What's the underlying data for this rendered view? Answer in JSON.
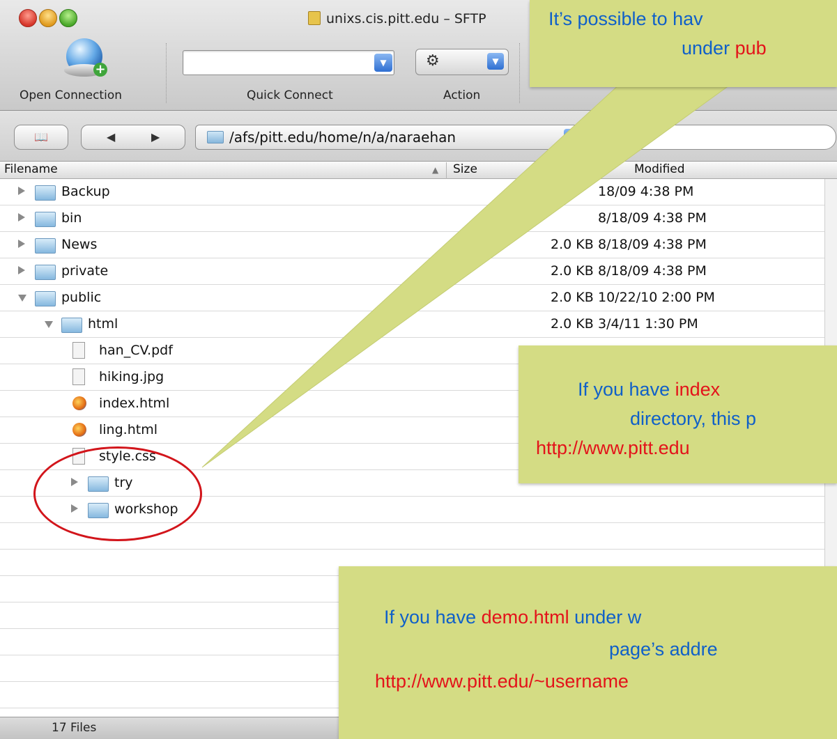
{
  "window": {
    "title": "unixs.cis.pitt.edu – SFTP"
  },
  "toolbar": {
    "open_connection": "Open Connection",
    "quick_connect": "Quick Connect",
    "action": "Action"
  },
  "nav": {
    "path": "/afs/pitt.edu/home/n/a/naraehan"
  },
  "columns": {
    "filename": "Filename",
    "size": "Size",
    "modified": "Modified"
  },
  "files": [
    {
      "name": "Backup",
      "kind": "folder-special",
      "disclosure": "closed",
      "depth": 0,
      "size": "",
      "modified": "18/09 4:38 PM"
    },
    {
      "name": "bin",
      "kind": "folder-special",
      "disclosure": "closed",
      "depth": 0,
      "size": "",
      "modified": "8/18/09 4:38 PM"
    },
    {
      "name": "News",
      "kind": "folder",
      "disclosure": "closed",
      "depth": 0,
      "size": "2.0 KB",
      "modified": "8/18/09 4:38 PM"
    },
    {
      "name": "private",
      "kind": "folder",
      "disclosure": "closed",
      "depth": 0,
      "size": "2.0 KB",
      "modified": "8/18/09 4:38 PM"
    },
    {
      "name": "public",
      "kind": "folder",
      "disclosure": "open",
      "depth": 0,
      "size": "2.0 KB",
      "modified": "10/22/10 2:00 PM"
    },
    {
      "name": "html",
      "kind": "folder",
      "disclosure": "open",
      "depth": 1,
      "size": "2.0 KB",
      "modified": "3/4/11 1:30 PM"
    },
    {
      "name": "han_CV.pdf",
      "kind": "file",
      "disclosure": "none",
      "depth": 2,
      "size": "",
      "modified": ""
    },
    {
      "name": "hiking.jpg",
      "kind": "file",
      "disclosure": "none",
      "depth": 2,
      "size": "",
      "modified": ""
    },
    {
      "name": "index.html",
      "kind": "html",
      "disclosure": "none",
      "depth": 2,
      "size": "",
      "modified": ""
    },
    {
      "name": "ling.html",
      "kind": "html",
      "disclosure": "none",
      "depth": 2,
      "size": "",
      "modified": ""
    },
    {
      "name": "style.css",
      "kind": "file",
      "disclosure": "none",
      "depth": 2,
      "size": "",
      "modified": ""
    },
    {
      "name": "try",
      "kind": "folder",
      "disclosure": "closed",
      "depth": 2,
      "size": "",
      "modified": ""
    },
    {
      "name": "workshop",
      "kind": "folder",
      "disclosure": "closed",
      "depth": 2,
      "size": "",
      "modified": ""
    }
  ],
  "status": {
    "count": "17 Files"
  },
  "callouts": {
    "top": {
      "line1": "It’s possible to hav",
      "line2a": "under ",
      "line2b": "pub"
    },
    "middle": {
      "line1a": "If you have ",
      "line1b": "index",
      "line2": "directory, this p",
      "line3": "http://www.pitt.edu"
    },
    "bottom": {
      "line1a": "If you have ",
      "line1b": "demo.html",
      "line1c": " under w",
      "line2": "page’s addre",
      "line3": "http://www.pitt.edu/~username"
    }
  },
  "colors": {
    "callout_bg": "#d4dc84",
    "callout_text": "#1060c8",
    "highlight": "#e3131a"
  }
}
